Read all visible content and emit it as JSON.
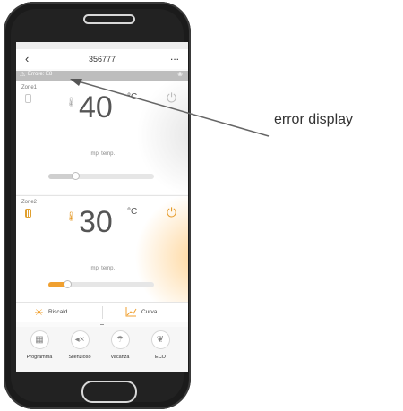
{
  "header": {
    "back_icon": "chevron-left-icon",
    "title": "356777",
    "more_label": "..."
  },
  "error_bar": {
    "icon": "warning-icon",
    "text": "Errore: E8",
    "close_icon": "close-circle-icon"
  },
  "zones": [
    {
      "label": "Zone1",
      "temperature": "40",
      "unit": "°C",
      "caption": "Imp. temp.",
      "slider_level": 0.25,
      "active": false
    },
    {
      "label": "Zone2",
      "temperature": "30",
      "unit": "°C",
      "caption": "Imp. temp.",
      "slider_level": 0.18,
      "active": true
    }
  ],
  "modes": {
    "left_label": "Riscald",
    "right_label": "Curva"
  },
  "bottom_bar": [
    {
      "label": "Programma",
      "icon": "calendar-icon"
    },
    {
      "label": "Silenzioso",
      "icon": "mute-icon"
    },
    {
      "label": "Vacanza",
      "icon": "beach-umbrella-icon"
    },
    {
      "label": "ECO",
      "icon": "eco-leaf-icon"
    }
  ],
  "annotation": {
    "text": "error display"
  },
  "colors": {
    "accent": "#f0a030",
    "error_bar": "#bdbdbd",
    "phone_body": "#1b1b1b"
  }
}
